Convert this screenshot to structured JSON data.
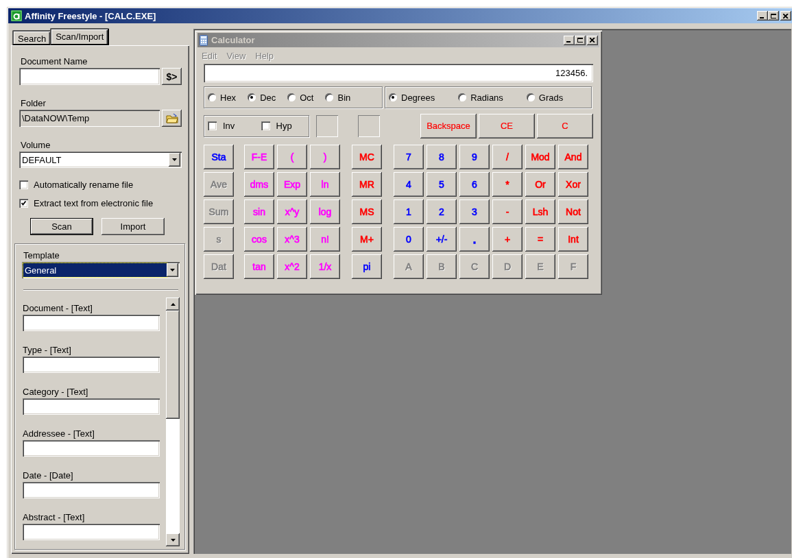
{
  "window": {
    "title": "Affinity Freestyle - [CALC.EXE]"
  },
  "tabs": [
    {
      "label": "Search",
      "selected": false
    },
    {
      "label": "Scan/Import",
      "selected": true
    }
  ],
  "scan_import": {
    "document_name": {
      "label": "Document Name"
    },
    "insert_button": "$>",
    "folder": {
      "label": "Folder",
      "value": "\\DataNOW\\Temp"
    },
    "volume": {
      "label": "Volume",
      "value": "DEFAULT"
    },
    "options": [
      {
        "label": "Automatically rename file",
        "checked": false
      },
      {
        "label": "Extract text from electronic file",
        "checked": true
      }
    ],
    "buttons": [
      {
        "label": "Scan",
        "default": true
      },
      {
        "label": "Import",
        "default": false
      }
    ]
  },
  "template": {
    "label": "Template",
    "value": "General"
  },
  "fields": [
    {
      "label": "Document - [Text]"
    },
    {
      "label": "Type - [Text]"
    },
    {
      "label": "Category - [Text]"
    },
    {
      "label": "Addressee - [Text]"
    },
    {
      "label": "Date - [Date]"
    },
    {
      "label": "Abstract - [Text]"
    }
  ],
  "calculator": {
    "title": "Calculator",
    "menu": [
      "Edit",
      "View",
      "Help"
    ],
    "display": "123456.",
    "number_bases": [
      {
        "label": "Hex",
        "selected": false
      },
      {
        "label": "Dec",
        "selected": true
      },
      {
        "label": "Oct",
        "selected": false
      },
      {
        "label": "Bin",
        "selected": false
      }
    ],
    "angle_units": [
      {
        "label": "Degrees",
        "selected": true
      },
      {
        "label": "Radians",
        "selected": false
      },
      {
        "label": "Grads",
        "selected": false
      }
    ],
    "toggles": [
      {
        "label": "Inv",
        "checked": false
      },
      {
        "label": "Hyp",
        "checked": false
      }
    ],
    "edit_buttons": [
      {
        "label": "Backspace",
        "color": "#ff0000"
      },
      {
        "label": "CE",
        "color": "#ff0000"
      },
      {
        "label": "C",
        "color": "#ff0000"
      }
    ],
    "button_rows": [
      [
        {
          "label": "Sta",
          "color": "#0000ff",
          "disabled": false
        },
        {
          "label": "F-E",
          "color": "#ff00ff",
          "disabled": false
        },
        {
          "label": "(",
          "color": "#ff00ff",
          "disabled": false
        },
        {
          "label": ")",
          "color": "#ff00ff",
          "disabled": false
        },
        {
          "label": "MC",
          "color": "#ff0000",
          "disabled": false
        },
        {
          "label": "7",
          "color": "#0000ff",
          "disabled": false
        },
        {
          "label": "8",
          "color": "#0000ff",
          "disabled": false
        },
        {
          "label": "9",
          "color": "#0000ff",
          "disabled": false
        },
        {
          "label": "/",
          "color": "#ff0000",
          "disabled": false
        },
        {
          "label": "Mod",
          "color": "#ff0000",
          "disabled": false
        },
        {
          "label": "And",
          "color": "#ff0000",
          "disabled": false
        }
      ],
      [
        {
          "label": "Ave",
          "color": "#808080",
          "disabled": true
        },
        {
          "label": "dms",
          "color": "#ff00ff",
          "disabled": false
        },
        {
          "label": "Exp",
          "color": "#ff00ff",
          "disabled": false
        },
        {
          "label": "ln",
          "color": "#ff00ff",
          "disabled": false
        },
        {
          "label": "MR",
          "color": "#ff0000",
          "disabled": false
        },
        {
          "label": "4",
          "color": "#0000ff",
          "disabled": false
        },
        {
          "label": "5",
          "color": "#0000ff",
          "disabled": false
        },
        {
          "label": "6",
          "color": "#0000ff",
          "disabled": false
        },
        {
          "label": "*",
          "color": "#ff0000",
          "disabled": false
        },
        {
          "label": "Or",
          "color": "#ff0000",
          "disabled": false
        },
        {
          "label": "Xor",
          "color": "#ff0000",
          "disabled": false
        }
      ],
      [
        {
          "label": "Sum",
          "color": "#808080",
          "disabled": true
        },
        {
          "label": "sin",
          "color": "#ff00ff",
          "disabled": false
        },
        {
          "label": "x^y",
          "color": "#ff00ff",
          "disabled": false
        },
        {
          "label": "log",
          "color": "#ff00ff",
          "disabled": false
        },
        {
          "label": "MS",
          "color": "#ff0000",
          "disabled": false
        },
        {
          "label": "1",
          "color": "#0000ff",
          "disabled": false
        },
        {
          "label": "2",
          "color": "#0000ff",
          "disabled": false
        },
        {
          "label": "3",
          "color": "#0000ff",
          "disabled": false
        },
        {
          "label": "-",
          "color": "#ff0000",
          "disabled": false
        },
        {
          "label": "Lsh",
          "color": "#ff0000",
          "disabled": false
        },
        {
          "label": "Not",
          "color": "#ff0000",
          "disabled": false
        }
      ],
      [
        {
          "label": "s",
          "color": "#808080",
          "disabled": true
        },
        {
          "label": "cos",
          "color": "#ff00ff",
          "disabled": false
        },
        {
          "label": "x^3",
          "color": "#ff00ff",
          "disabled": false
        },
        {
          "label": "n!",
          "color": "#ff00ff",
          "disabled": false
        },
        {
          "label": "M+",
          "color": "#ff0000",
          "disabled": false
        },
        {
          "label": "0",
          "color": "#0000ff",
          "disabled": false
        },
        {
          "label": "+/-",
          "color": "#0000ff",
          "disabled": false
        },
        {
          "label": ".",
          "color": "#0000ff",
          "disabled": false
        },
        {
          "label": "+",
          "color": "#ff0000",
          "disabled": false
        },
        {
          "label": "=",
          "color": "#ff0000",
          "disabled": false
        },
        {
          "label": "Int",
          "color": "#ff0000",
          "disabled": false
        }
      ],
      [
        {
          "label": "Dat",
          "color": "#808080",
          "disabled": true
        },
        {
          "label": "tan",
          "color": "#ff00ff",
          "disabled": false
        },
        {
          "label": "x^2",
          "color": "#ff00ff",
          "disabled": false
        },
        {
          "label": "1/x",
          "color": "#ff00ff",
          "disabled": false
        },
        {
          "label": "pi",
          "color": "#0000ff",
          "disabled": false
        },
        {
          "label": "A",
          "color": "#808080",
          "disabled": true
        },
        {
          "label": "B",
          "color": "#808080",
          "disabled": true
        },
        {
          "label": "C",
          "color": "#808080",
          "disabled": true
        },
        {
          "label": "D",
          "color": "#808080",
          "disabled": true
        },
        {
          "label": "E",
          "color": "#808080",
          "disabled": true
        },
        {
          "label": "F",
          "color": "#808080",
          "disabled": true
        }
      ]
    ]
  }
}
